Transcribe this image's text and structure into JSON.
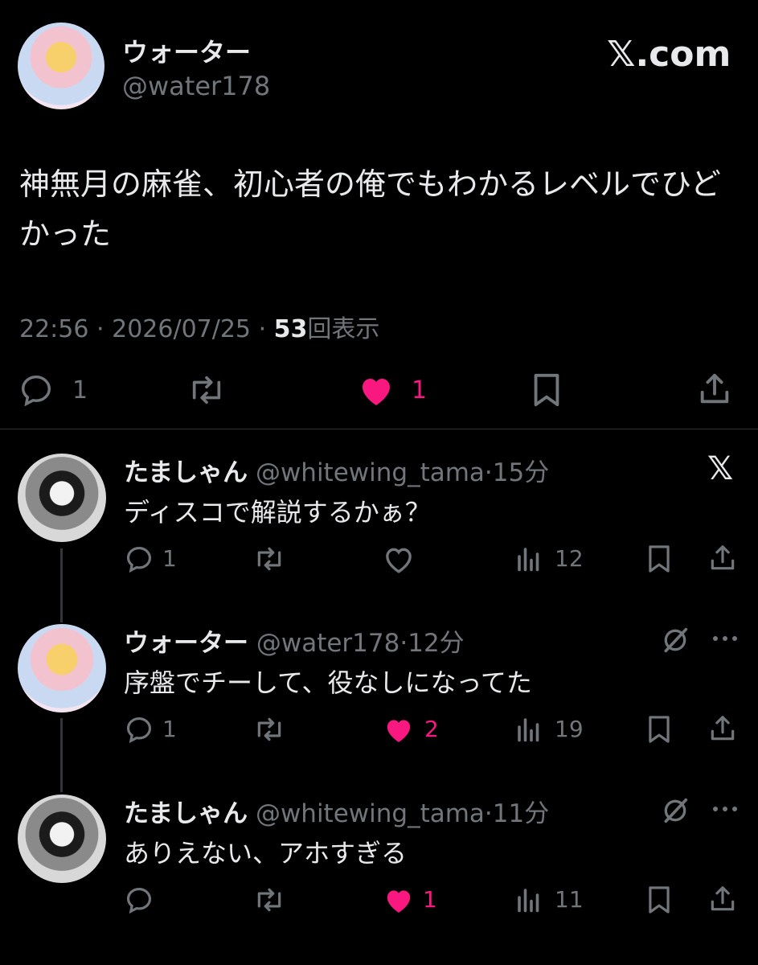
{
  "main_post": {
    "display_name": "ウォーター",
    "handle": "@water178",
    "brand": "𝕏.com",
    "text": "神無月の麻雀、初心者の俺でもわかるレベルでひどかった",
    "time": "22:56",
    "date": "2026/07/25",
    "separator": "·",
    "views_count": "53",
    "views_label": "回表示",
    "actions": {
      "reply": "1",
      "repost": "",
      "like": "1"
    }
  },
  "replies": [
    {
      "display_name": "たましゃん",
      "handle": "@whitewing_tama",
      "time": "15分",
      "text": "ディスコで解説するかぁ？",
      "top_right_icon": "x-logo-icon",
      "reply_count": "1",
      "repost_count": "",
      "like_count": "",
      "liked": false,
      "views": "12"
    },
    {
      "display_name": "ウォーター",
      "handle": "@water178",
      "time": "12分",
      "text": "序盤でチーして、役なしになってた",
      "top_right_icon": "grok-icon",
      "reply_count": "1",
      "repost_count": "",
      "like_count": "2",
      "liked": true,
      "views": "19"
    },
    {
      "display_name": "たましゃん",
      "handle": "@whitewing_tama",
      "time": "11分",
      "text": "ありえない、アホすぎる",
      "top_right_icon": "grok-icon",
      "reply_count": "",
      "repost_count": "",
      "like_count": "1",
      "liked": true,
      "views": "11"
    }
  ],
  "colors": {
    "background": "#000000",
    "text": "#e7e9ea",
    "muted": "#71767b",
    "like": "#f91880",
    "divider": "#2f3336"
  }
}
